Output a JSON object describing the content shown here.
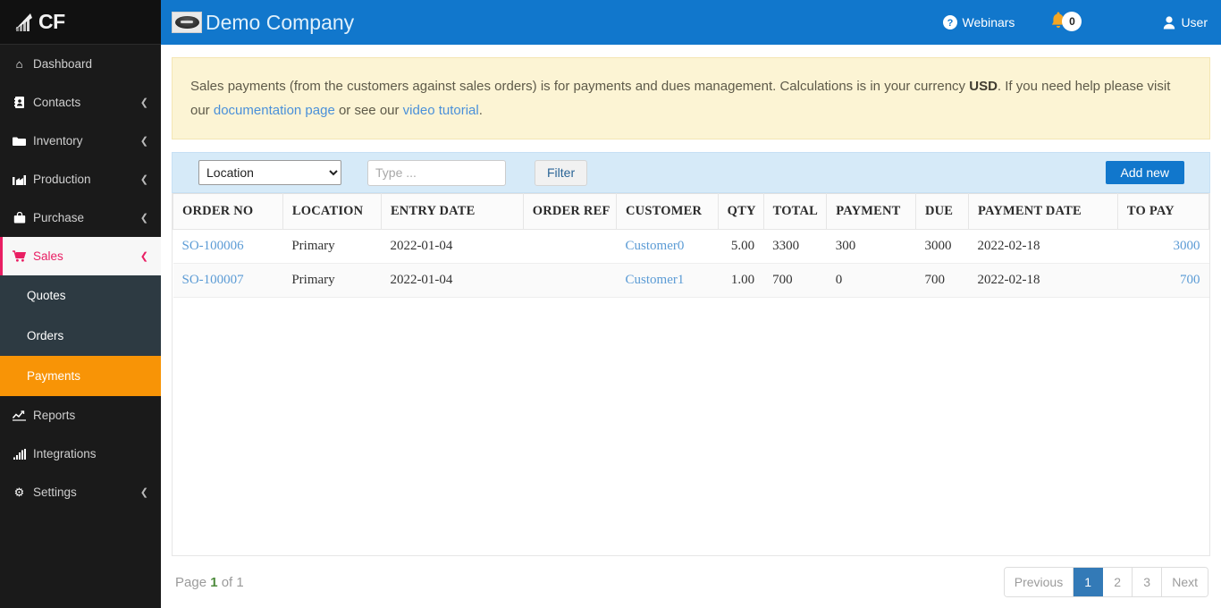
{
  "sidebar": {
    "brand": {
      "text": "CF",
      "icon": "bar-chart-arrow-logo"
    },
    "items": [
      {
        "label": "Dashboard",
        "icon": "home-icon",
        "caret": "",
        "active": false
      },
      {
        "label": "Contacts",
        "icon": "contacts-icon",
        "caret": "❮",
        "active": false
      },
      {
        "label": "Inventory",
        "icon": "folder-icon",
        "caret": "❮",
        "active": false
      },
      {
        "label": "Production",
        "icon": "factory-icon",
        "caret": "❮",
        "active": false
      },
      {
        "label": "Purchase",
        "icon": "shopping-bag-icon",
        "caret": "❮",
        "active": false
      },
      {
        "label": "Sales",
        "icon": "cart-icon",
        "caret": "❮",
        "active": true
      }
    ],
    "sales_submenu": [
      {
        "label": "Quotes",
        "active": false
      },
      {
        "label": "Orders",
        "active": false
      },
      {
        "label": "Payments",
        "active": true
      }
    ],
    "items_after": [
      {
        "label": "Reports",
        "icon": "line-chart-icon",
        "caret": "",
        "active": false
      },
      {
        "label": "Integrations",
        "icon": "signal-bars-icon",
        "caret": "",
        "active": false
      },
      {
        "label": "Settings",
        "icon": "gear-icon",
        "caret": "❮",
        "active": false
      }
    ],
    "accent_active": "#f89406",
    "accent_parent": "#e91e63"
  },
  "topbar": {
    "company": "Demo Company",
    "logo_icon": "company-oval-logo",
    "webinars": {
      "label": "Webinars",
      "icon": "question-circle-icon"
    },
    "notifications": {
      "icon": "bell-icon",
      "count": "0"
    },
    "user": {
      "label": "User",
      "icon": "user-icon"
    },
    "background": "#1177cc"
  },
  "alert": {
    "part1": "Sales payments (from the customers against sales orders) is for payments and dues management. Calculations is in your currency ",
    "currency": "USD",
    "part2": ". If you need help please visit our ",
    "link1": "documentation page",
    "part3": " or see our ",
    "link2": "video tutorial",
    "part4": "."
  },
  "toolbar": {
    "select_value": "Location",
    "select_options": [
      "Location"
    ],
    "search_placeholder": "Type ...",
    "search_value": "",
    "filter_label": "Filter",
    "add_label": "Add new"
  },
  "table": {
    "columns": [
      {
        "label": "ORDER NO",
        "align": "left"
      },
      {
        "label": "LOCATION",
        "align": "left"
      },
      {
        "label": "ENTRY DATE",
        "align": "left"
      },
      {
        "label": "ORDER REF",
        "align": "left"
      },
      {
        "label": "CUSTOMER",
        "align": "left"
      },
      {
        "label": "QTY",
        "align": "right"
      },
      {
        "label": "TOTAL",
        "align": "left"
      },
      {
        "label": "PAYMENT",
        "align": "left"
      },
      {
        "label": "DUE",
        "align": "left"
      },
      {
        "label": "PAYMENT DATE",
        "align": "left"
      },
      {
        "label": "TO PAY",
        "align": "right"
      }
    ],
    "rows": [
      {
        "order_no": "SO-100006",
        "location": "Primary",
        "entry_date": "2022-01-04",
        "order_ref": "",
        "customer": "Customer0",
        "qty": "5.00",
        "total": "3300",
        "payment": "300",
        "due": "3000",
        "payment_date": "2022-02-18",
        "to_pay": "3000"
      },
      {
        "order_no": "SO-100007",
        "location": "Primary",
        "entry_date": "2022-01-04",
        "order_ref": "",
        "customer": "Customer1",
        "qty": "1.00",
        "total": "700",
        "payment": "0",
        "due": "700",
        "payment_date": "2022-02-18",
        "to_pay": "700"
      }
    ]
  },
  "pager": {
    "prefix": "Page ",
    "current": "1",
    "middle": " of ",
    "total": "1",
    "previous": "Previous",
    "pages": [
      "1",
      "2",
      "3"
    ],
    "active_page": "1",
    "next": "Next"
  }
}
